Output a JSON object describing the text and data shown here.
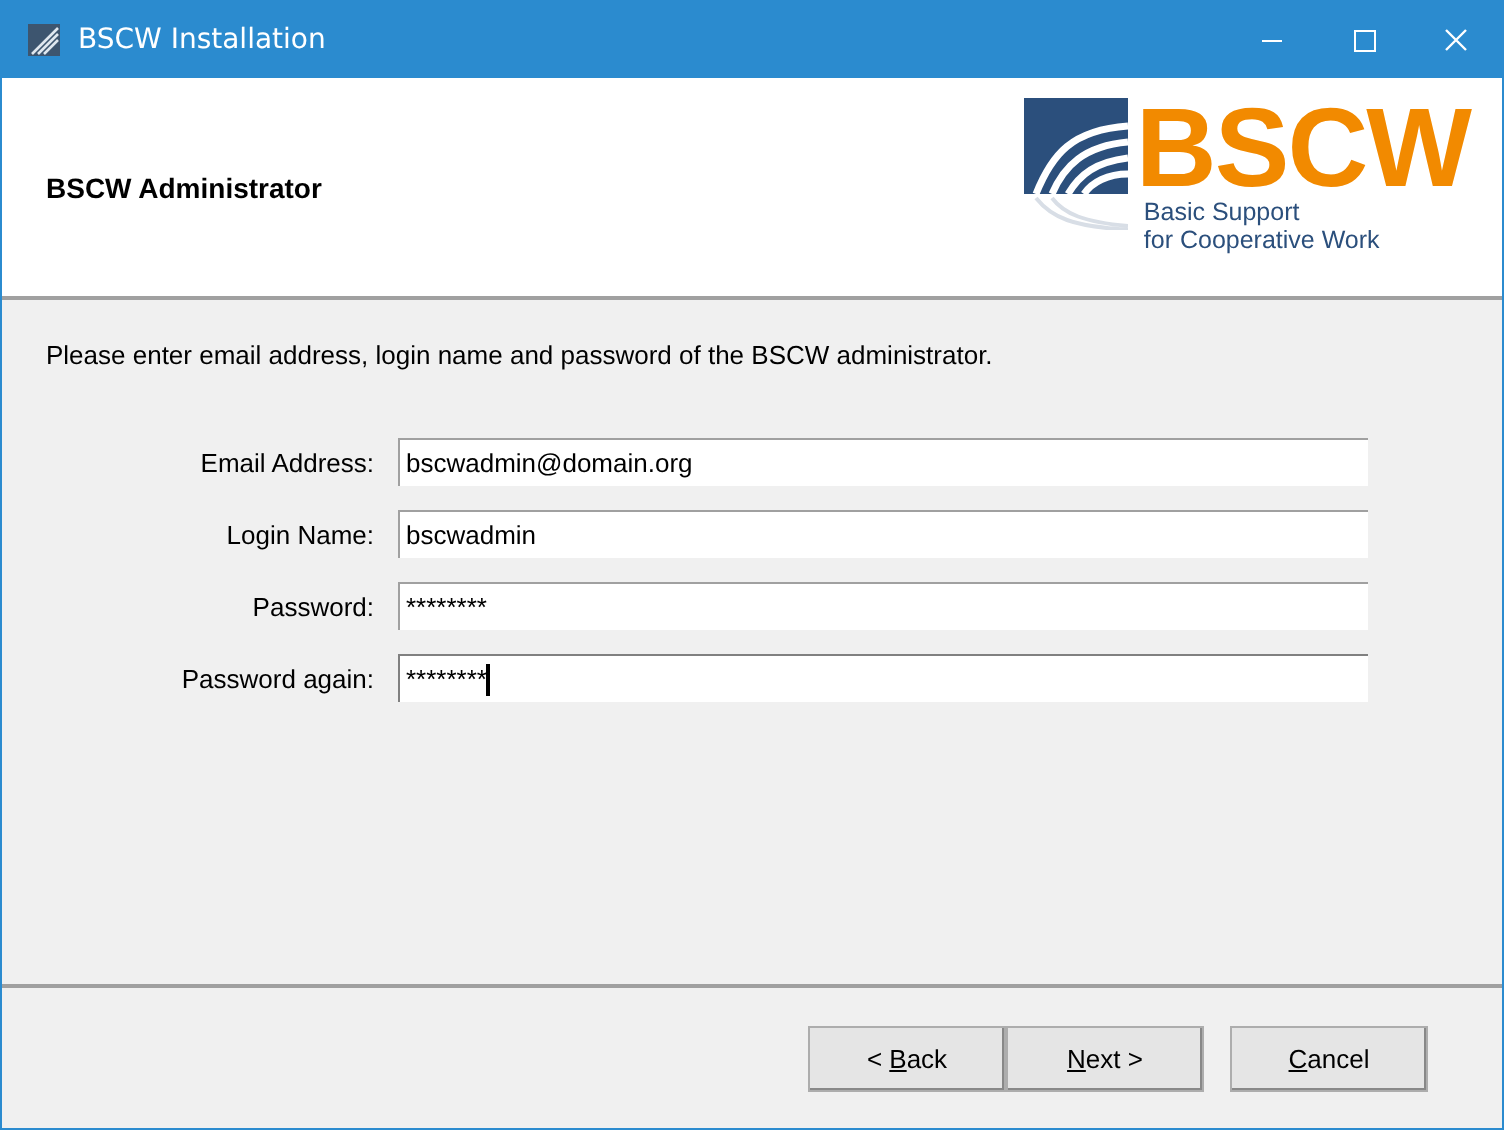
{
  "window": {
    "title": "BSCW Installation"
  },
  "header": {
    "title": "BSCW Administrator",
    "logo": {
      "name": "BSCW",
      "tagline_1": "Basic Support",
      "tagline_2": "for Cooperative Work"
    }
  },
  "instruction": "Please enter email address, login name and password of the BSCW administrator.",
  "fields": [
    {
      "label": "Email Address:",
      "value": "bscwadmin@domain.org",
      "focused": false
    },
    {
      "label": "Login Name:",
      "value": "bscwadmin",
      "focused": false
    },
    {
      "label": "Password:",
      "value": "********",
      "focused": false
    },
    {
      "label": "Password again:",
      "value": "********",
      "focused": true
    }
  ],
  "buttons": [
    {
      "label": [
        {
          "text": "< ",
          "underlined": false
        },
        {
          "text": "B",
          "underlined": true
        },
        {
          "text": "ack",
          "underlined": false
        }
      ]
    },
    {
      "label": [
        {
          "text": "N",
          "underlined": true
        },
        {
          "text": "ext >",
          "underlined": false
        }
      ]
    },
    {
      "label": [
        {
          "text": "C",
          "underlined": true
        },
        {
          "text": "ancel",
          "underlined": false
        }
      ]
    }
  ]
}
